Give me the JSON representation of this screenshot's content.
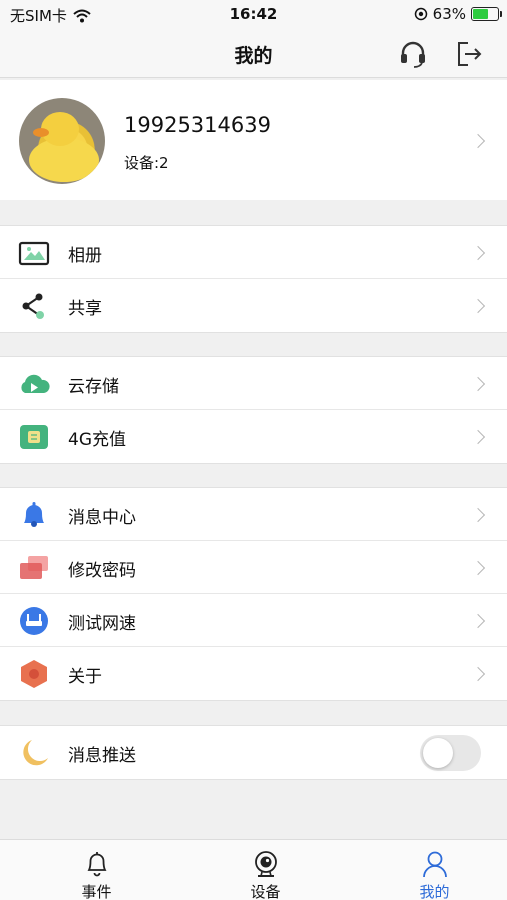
{
  "status_bar": {
    "carrier": "无SIM卡",
    "time": "16:42",
    "battery_percent": "63%",
    "battery_level": 0.63
  },
  "nav": {
    "title": "我的",
    "icons": [
      "headset-icon",
      "logout-icon"
    ]
  },
  "profile": {
    "phone": "19925314639",
    "devices": "设备:2"
  },
  "groups": [
    {
      "items": [
        {
          "label": "相册",
          "icon": "album-icon"
        },
        {
          "label": "共享",
          "icon": "share-icon"
        }
      ]
    },
    {
      "items": [
        {
          "label": "云存储",
          "icon": "cloud-storage-icon"
        },
        {
          "label": "4G充值",
          "icon": "sim-card-icon"
        }
      ]
    },
    {
      "items": [
        {
          "label": "消息中心",
          "icon": "bell-icon"
        },
        {
          "label": "修改密码",
          "icon": "password-icon"
        },
        {
          "label": "测试网速",
          "icon": "router-icon"
        },
        {
          "label": "关于",
          "icon": "hexagon-icon"
        }
      ]
    },
    {
      "items": [
        {
          "label": "消息推送",
          "icon": "moon-icon",
          "toggle": false
        }
      ]
    }
  ],
  "tabs": [
    {
      "label": "事件",
      "icon": "bell-outline-icon",
      "active": false
    },
    {
      "label": "设备",
      "icon": "camera-icon",
      "active": false
    },
    {
      "label": "我的",
      "icon": "person-icon",
      "active": true
    }
  ],
  "colors": {
    "accent": "#2d6bd8",
    "chevron": "#b7b7b7",
    "background": "#f0f0f0"
  }
}
